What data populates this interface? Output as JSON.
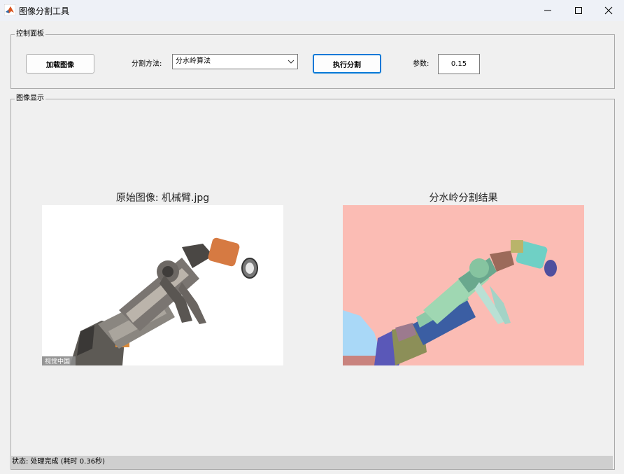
{
  "window": {
    "title": "图像分割工具"
  },
  "control_panel": {
    "title": "控制面板",
    "load_button": "加载图像",
    "method_label": "分割方法:",
    "method_value": "分水岭算法",
    "run_button": "执行分割",
    "param_label": "参数:",
    "param_value": "0.15"
  },
  "display_panel": {
    "title": "图像显示",
    "original_title": "原始图像: 机械臂.jpg",
    "result_title": "分水岭分割结果",
    "watermark": "视觉中国"
  },
  "status": {
    "text": "状态: 处理完成 (耗时 0.36秒)"
  },
  "colors": {
    "result_background": "#fbbcb4",
    "accent": "#0078d7"
  }
}
